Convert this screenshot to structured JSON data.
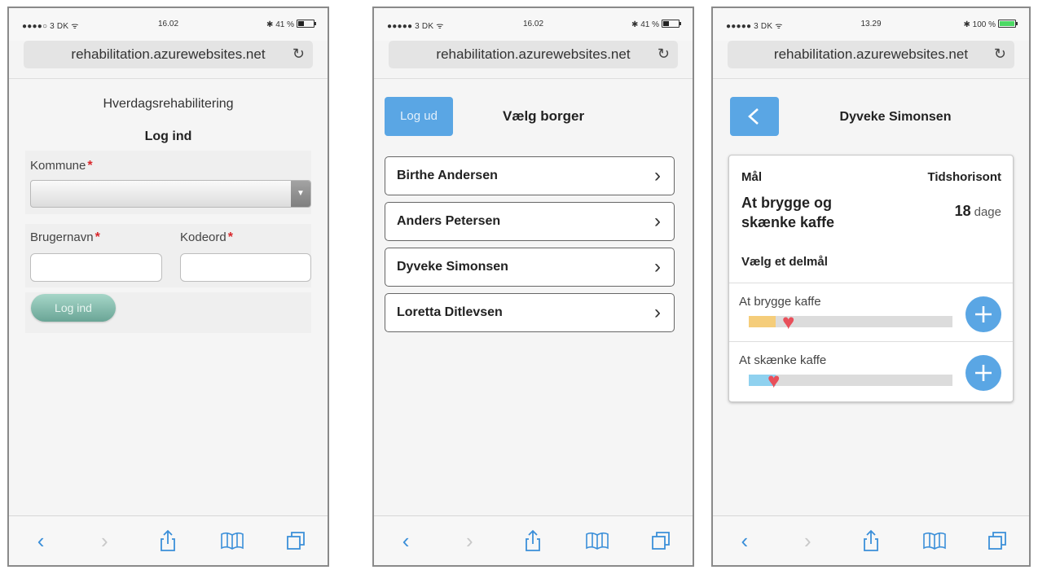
{
  "phones": [
    {
      "status": {
        "carrier": "●●●●○ 3 DK ᯤ",
        "time": "16.02",
        "battery": "✱ 41 %"
      },
      "url": "rehabilitation.azurewebsites.net"
    },
    {
      "status": {
        "carrier": "●●●●● 3 DK ᯤ",
        "time": "16.02",
        "battery": "✱ 41 %"
      },
      "url": "rehabilitation.azurewebsites.net"
    },
    {
      "status": {
        "carrier": "●●●●● 3 DK ᯤ",
        "time": "13.29",
        "battery": "✱ 100 %"
      },
      "url": "rehabilitation.azurewebsites.net"
    }
  ],
  "login": {
    "app_name": "Hverdagsrehabilitering",
    "title": "Log ind",
    "kommune_label": "Kommune",
    "required_mark": "*",
    "username_label": "Brugernavn",
    "password_label": "Kodeord",
    "login_button": "Log ind"
  },
  "choose_citizen": {
    "logout_button": "Log ud",
    "title": "Vælg borger",
    "citizens": [
      {
        "name": "Birthe Andersen"
      },
      {
        "name": "Anders Petersen"
      },
      {
        "name": "Dyveke Simonsen"
      },
      {
        "name": "Loretta Ditlevsen"
      }
    ]
  },
  "goal": {
    "citizen_name": "Dyveke Simonsen",
    "goal_header": "Mål",
    "horizon_header": "Tidshorisont",
    "goal_name": "At brygge og skænke kaffe",
    "days_value": "18",
    "days_unit": "dage",
    "subgoal_prompt": "Vælg et delmål",
    "subgoals": [
      {
        "name": "At brygge kaffe",
        "progress": 0.13,
        "color": "#f5cd7a"
      },
      {
        "name": "At skænke kaffe",
        "progress": 0.13,
        "color": "#8fd1ef"
      }
    ]
  },
  "colors": {
    "accent_blue": "#5aa6e4",
    "heart": "#e84f5a",
    "required": "#d9262a",
    "login_button": "#86bcae"
  }
}
